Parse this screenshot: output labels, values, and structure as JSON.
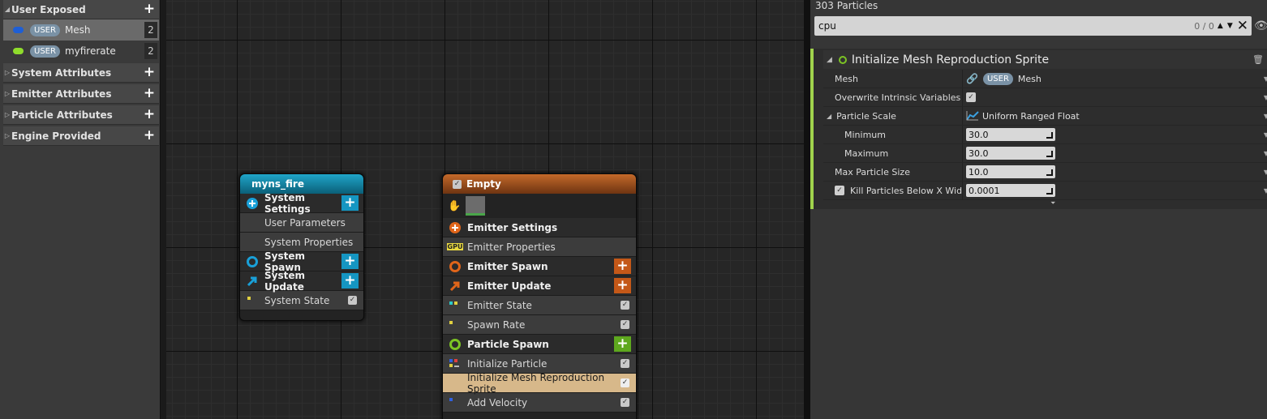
{
  "parameters_panel": {
    "user_exposed": {
      "label": "User Exposed",
      "items": [
        {
          "badge": "USER",
          "name": "Mesh",
          "count": "2",
          "dot_color": "#1e5fd6"
        },
        {
          "badge": "USER",
          "name": "myfirerate",
          "count": "2",
          "dot_color": "#8fdc2c"
        }
      ]
    },
    "categories": [
      "System Attributes",
      "Emitter Attributes",
      "Particle Attributes",
      "Engine Provided"
    ]
  },
  "graph": {
    "system_node": {
      "title": "myns_fire",
      "header_color": "#0f8fb2",
      "rows": [
        {
          "label": "System Settings",
          "kind": "group",
          "add": true
        },
        {
          "label": "User Parameters",
          "kind": "item"
        },
        {
          "label": "System Properties",
          "kind": "item"
        },
        {
          "label": "System Spawn",
          "kind": "group",
          "add": true
        },
        {
          "label": "System Update",
          "kind": "group",
          "add": true
        },
        {
          "label": "System State",
          "kind": "item",
          "check": true
        }
      ]
    },
    "emitter_node": {
      "title": "Empty",
      "header_color": "#a3521c",
      "rows": [
        {
          "label": "Emitter Settings",
          "kind": "group"
        },
        {
          "label": "Emitter Properties",
          "kind": "item",
          "badge": "GPU"
        },
        {
          "label": "Emitter Spawn",
          "kind": "group",
          "add": true
        },
        {
          "label": "Emitter Update",
          "kind": "group",
          "add": true
        },
        {
          "label": "Emitter State",
          "kind": "item",
          "check": true
        },
        {
          "label": "Spawn Rate",
          "kind": "item",
          "check": true
        },
        {
          "label": "Particle Spawn",
          "kind": "group",
          "add": true
        },
        {
          "label": "Initialize Particle",
          "kind": "item",
          "check": true
        },
        {
          "label": "Initialize Mesh Reproduction Sprite",
          "kind": "item",
          "check": true,
          "selected": true
        },
        {
          "label": "Add Velocity",
          "kind": "item",
          "check": true
        }
      ]
    }
  },
  "details_panel": {
    "particles_count": "303 Particles",
    "search": {
      "value": "cpu",
      "count": "0 / 0"
    },
    "module_title": "Initialize Mesh Reproduction Sprite",
    "properties": {
      "mesh": {
        "label": "Mesh",
        "badge": "USER",
        "value": "Mesh"
      },
      "overwrite": {
        "label": "Overwrite Intrinsic Variables"
      },
      "particle_scale": {
        "label": "Particle Scale",
        "value": "Uniform Ranged Float"
      },
      "minimum": {
        "label": "Minimum",
        "value": "30.0"
      },
      "maximum": {
        "label": "Maximum",
        "value": "30.0"
      },
      "max_particle_size": {
        "label": "Max Particle Size",
        "value": "10.0"
      },
      "kill_particles": {
        "label": "Kill Particles Below X Wid",
        "value": "0.0001"
      }
    }
  }
}
